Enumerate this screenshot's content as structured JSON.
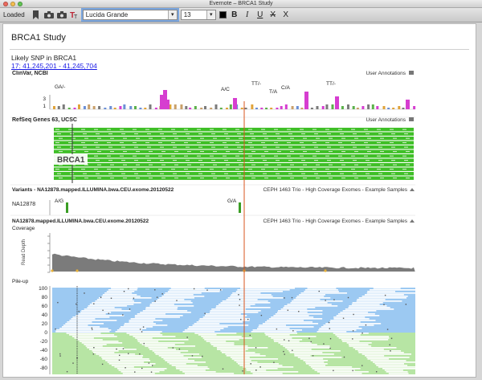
{
  "window": {
    "title": "Evernote – BRCA1 Study"
  },
  "toolbar": {
    "status": "Loaded",
    "font_value": "Lucida Grande",
    "size_value": "13",
    "bold": "B",
    "italic": "I",
    "underline": "U",
    "strikethrough": "X",
    "delete": "X",
    "font_color": "#000000"
  },
  "note": {
    "title": "BRCA1 Study",
    "snp_text": "Likely SNP in BRCA1",
    "location_link": "17: 41,245,201 - 41,245,704"
  },
  "tracks": {
    "clinvar": {
      "title": "ClinVar, NCBI",
      "right_label": "User Annotations",
      "ticks": [
        "3",
        "1"
      ],
      "variant_labels": [
        "GA/-",
        "A/C",
        "TT/-",
        "T/A",
        "C/A",
        "TT/-"
      ]
    },
    "refseq": {
      "title": "RefSeq Genes 63, UCSC",
      "right_label": "User Annotations",
      "gene": "BRCA1"
    },
    "variants": {
      "title": "Variants - NA12878.mapped.ILLUMINA.bwa.CEU.exome.20120522",
      "right_label": "CEPH 1463 Trio - High Coverage Exomes - Example Samples",
      "sample": "NA12878",
      "calls": [
        "A/G",
        "G/A"
      ]
    },
    "coverage": {
      "title": "NA12878.mapped.ILLUMINA.bwa.CEU.exome.20120522",
      "right_label": "CEPH 1463 Trio - High Coverage Exomes - Example Samples",
      "subtitle": "Coverage",
      "y_label": "Read Depth"
    },
    "pileup": {
      "title": "Pile-up",
      "ticks": [
        "100",
        "80",
        "60",
        "40",
        "20",
        "0",
        "-20",
        "-40",
        "-60",
        "-80"
      ]
    }
  },
  "colors": {
    "gene_green": "#3fbf27",
    "forward_reads": "#9cc9f2",
    "reverse_reads": "#b7e5a4",
    "position_marker": "#d9541c",
    "clinvar_magenta": "#d63ed0",
    "coverage_gray": "#7b7b7b"
  }
}
